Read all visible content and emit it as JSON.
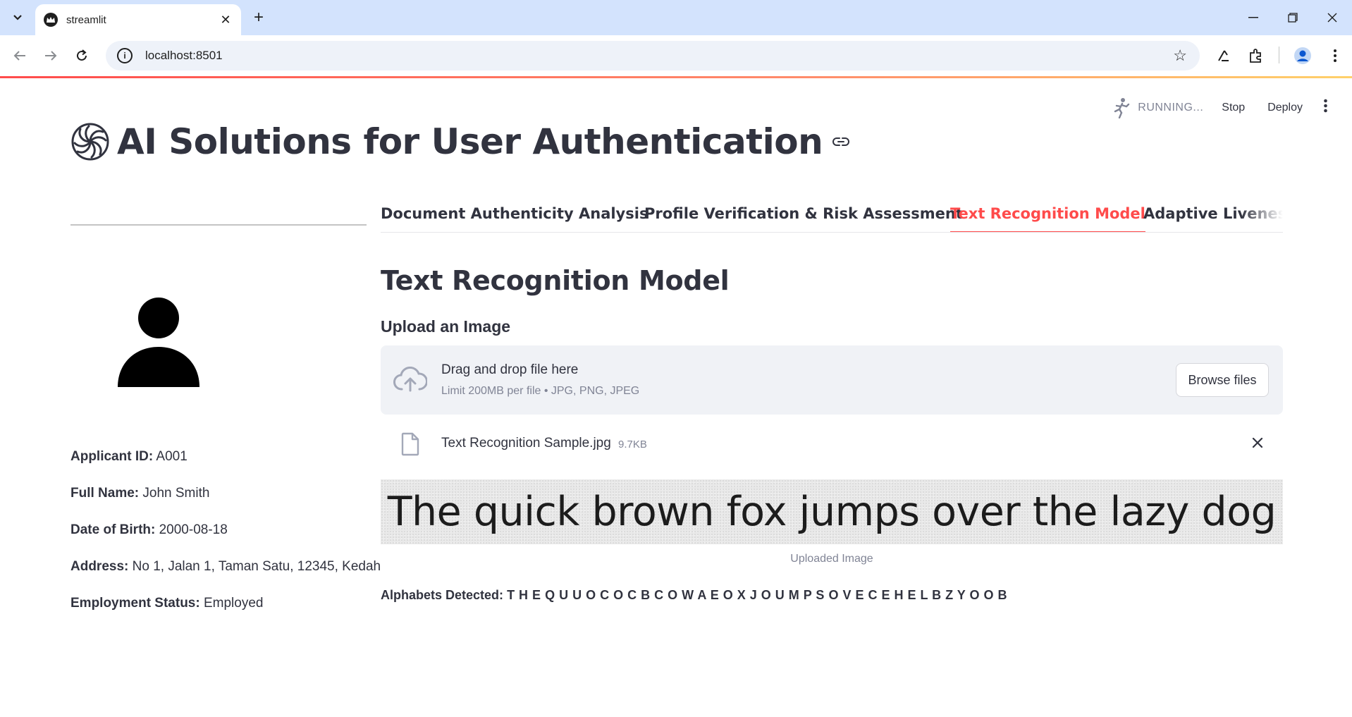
{
  "browser": {
    "tab_title": "streamlit",
    "url": "localhost:8501"
  },
  "header": {
    "status": "RUNNING...",
    "stop_label": "Stop",
    "deploy_label": "Deploy"
  },
  "page": {
    "title": "AI Solutions for User Authentication"
  },
  "applicant": {
    "fields": [
      {
        "label": "Applicant ID:",
        "value": "A001"
      },
      {
        "label": "Full Name:",
        "value": "John Smith"
      },
      {
        "label": "Date of Birth:",
        "value": "2000-08-18"
      },
      {
        "label": "Address:",
        "value": "No 1, Jalan 1, Taman Satu, 12345, Kedah"
      },
      {
        "label": "Employment Status:",
        "value": "Employed"
      }
    ]
  },
  "tabs": [
    {
      "label": "Document Authenticity Analysis",
      "active": false
    },
    {
      "label": "Profile Verification & Risk Assessment",
      "active": false
    },
    {
      "label": "Text Recognition Model",
      "active": true
    },
    {
      "label": "Adaptive Liveness",
      "active": false
    }
  ],
  "main": {
    "section_title": "Text Recognition Model",
    "upload_label": "Upload an Image",
    "dropzone": {
      "main_text": "Drag and drop file here",
      "sub_text": "Limit 200MB per file • JPG, PNG, JPEG",
      "browse_label": "Browse files"
    },
    "file": {
      "name": "Text Recognition Sample.jpg",
      "size": "9.7KB"
    },
    "image_text": "The quick brown fox jumps over the lazy dog",
    "image_caption": "Uploaded Image",
    "detected_label": "Alphabets Detected:",
    "detected_value": "T H E Q U U O C O C B C O W A E O X J O U M P S O V E C E H E L B Z Y O O B"
  },
  "colors": {
    "accent": "#ff4b4b",
    "text": "#31333f",
    "muted": "#808495",
    "dropzone_bg": "#f0f2f6",
    "tabstrip_bg": "#d3e3fd"
  },
  "icons": {
    "tab_favicon": "streamlit-crown-icon",
    "title_logo": "spiral-logo-icon",
    "avatar": "person-avatar-icon",
    "upload": "cloud-upload-icon",
    "file": "file-icon",
    "remove": "close-icon"
  }
}
